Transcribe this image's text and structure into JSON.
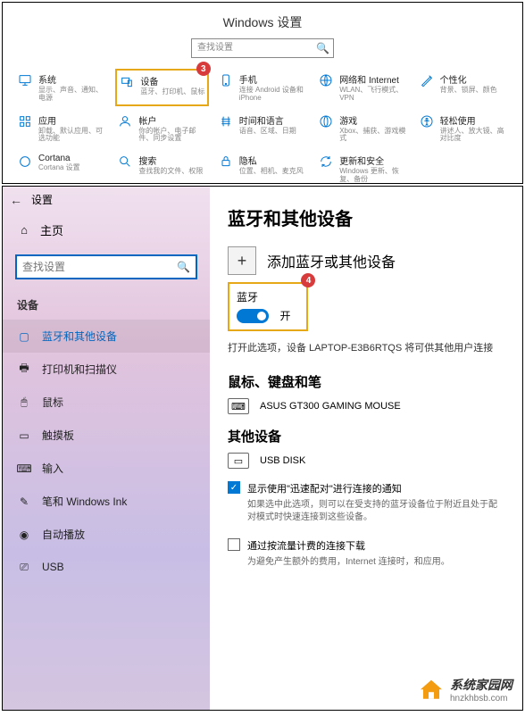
{
  "top": {
    "title": "Windows 设置",
    "search_placeholder": "查找设置",
    "badge3": "3",
    "tiles": [
      {
        "title": "系统",
        "sub": "显示、声音、通知、电源"
      },
      {
        "title": "设备",
        "sub": "蓝牙、打印机、鼠标"
      },
      {
        "title": "手机",
        "sub": "连接 Android 设备和 iPhone"
      },
      {
        "title": "网络和 Internet",
        "sub": "WLAN、飞行模式、VPN"
      },
      {
        "title": "个性化",
        "sub": "背景、锁屏、颜色"
      },
      {
        "title": "应用",
        "sub": "卸载、默认应用、可选功能"
      },
      {
        "title": "帐户",
        "sub": "你的帐户、电子邮件、同步设置"
      },
      {
        "title": "时间和语言",
        "sub": "语音、区域、日期"
      },
      {
        "title": "游戏",
        "sub": "Xbox、捕获、游戏模式"
      },
      {
        "title": "轻松使用",
        "sub": "讲述人、放大镜、高对比度"
      },
      {
        "title": "Cortana",
        "sub": "Cortana 设置"
      },
      {
        "title": "搜索",
        "sub": "查找我的文件、权限"
      },
      {
        "title": "隐私",
        "sub": "位置、相机、麦克风"
      },
      {
        "title": "更新和安全",
        "sub": "Windows 更新、恢复、备份"
      }
    ]
  },
  "bottom": {
    "window_title": "设置",
    "home": "主页",
    "search_placeholder": "查找设置",
    "section": "设备",
    "nav": [
      "蓝牙和其他设备",
      "打印机和扫描仪",
      "鼠标",
      "触摸板",
      "输入",
      "笔和 Windows Ink",
      "自动播放",
      "USB"
    ],
    "heading": "蓝牙和其他设备",
    "add_label": "添加蓝牙或其他设备",
    "bt_label": "蓝牙",
    "bt_state": "开",
    "badge4": "4",
    "bt_desc": "打开此选项，设备 LAPTOP-E3B6RTQS 将可供其他用户连接",
    "sec_mouse": "鼠标、键盘和笔",
    "dev_mouse": "ASUS GT300 GAMING MOUSE",
    "sec_other": "其他设备",
    "dev_usb": "USB DISK",
    "check1": "显示使用\"迅速配对\"进行连接的通知",
    "check1_hint": "如果选中此选项，则可以在受支持的蓝牙设备位于附近且处于配对模式时快速连接到这些设备。",
    "check2": "通过按流量计费的连接下载",
    "check2_hint": "为避免产生额外的费用，Internet 连接时，和应用。"
  },
  "watermark": {
    "name": "系统家园网",
    "url": "hnzkhbsb.com"
  }
}
